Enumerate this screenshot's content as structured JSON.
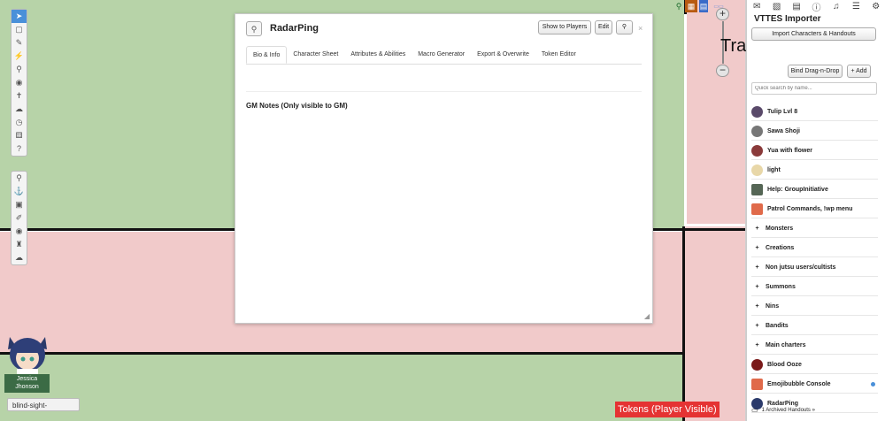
{
  "dialog": {
    "title": "RadarPing",
    "buttons": {
      "show": "Show to Players",
      "edit": "Edit"
    },
    "tabs": [
      "Bio & Info",
      "Character Sheet",
      "Attributes & Abilities",
      "Macro Generator",
      "Export & Overwrite",
      "Token Editor"
    ],
    "active_tab": "Bio & Info",
    "gm_notes_label": "GM Notes (Only visible to GM)"
  },
  "map": {
    "title_fragment": "Tra",
    "layer_label": "Tokens (Player Visible)",
    "avatar_name": "Jessica Jhonson",
    "blind_sight": "blind-sight-",
    "colors": {
      "green": "#b7d3a8",
      "pink": "#f1caca",
      "layer_red": "#e53333"
    }
  },
  "sidebar": {
    "title": "VTTES Importer",
    "import_button": "Import Characters & Handouts",
    "bind_button": "Bind Drag-n-Drop",
    "add_button": "+ Add",
    "search_placeholder": "Quick search by name...",
    "items": [
      {
        "label": "Tulip Lvl 8",
        "type": "character",
        "color": "#5a4a6a"
      },
      {
        "label": "Sawa Shoji",
        "type": "character",
        "color": "#777777"
      },
      {
        "label": "Yua with flower",
        "type": "character",
        "color": "#8a3a3a"
      },
      {
        "label": "light",
        "type": "character",
        "color": "#e8d7a8"
      },
      {
        "label": "Help: GroupInitiative",
        "type": "handout",
        "color": "#556655"
      },
      {
        "label": "Patrol Commands, !wp menu",
        "type": "handout",
        "color": "#e06a4a"
      },
      {
        "label": "Monsters",
        "type": "folder"
      },
      {
        "label": "Creations",
        "type": "folder"
      },
      {
        "label": "Non jutsu users/cultists",
        "type": "folder"
      },
      {
        "label": "Summons",
        "type": "folder"
      },
      {
        "label": "Nins",
        "type": "folder"
      },
      {
        "label": "Bandits",
        "type": "folder"
      },
      {
        "label": "Main charters",
        "type": "folder"
      },
      {
        "label": "Blood Ooze",
        "type": "character",
        "color": "#7a1a1a"
      },
      {
        "label": "Emojibubble Console",
        "type": "handout",
        "color": "#e06a4a",
        "dot": true
      },
      {
        "label": "RadarPing",
        "type": "character",
        "color": "#2b3a6b"
      }
    ],
    "archived": "1 Archived Handouts »"
  }
}
